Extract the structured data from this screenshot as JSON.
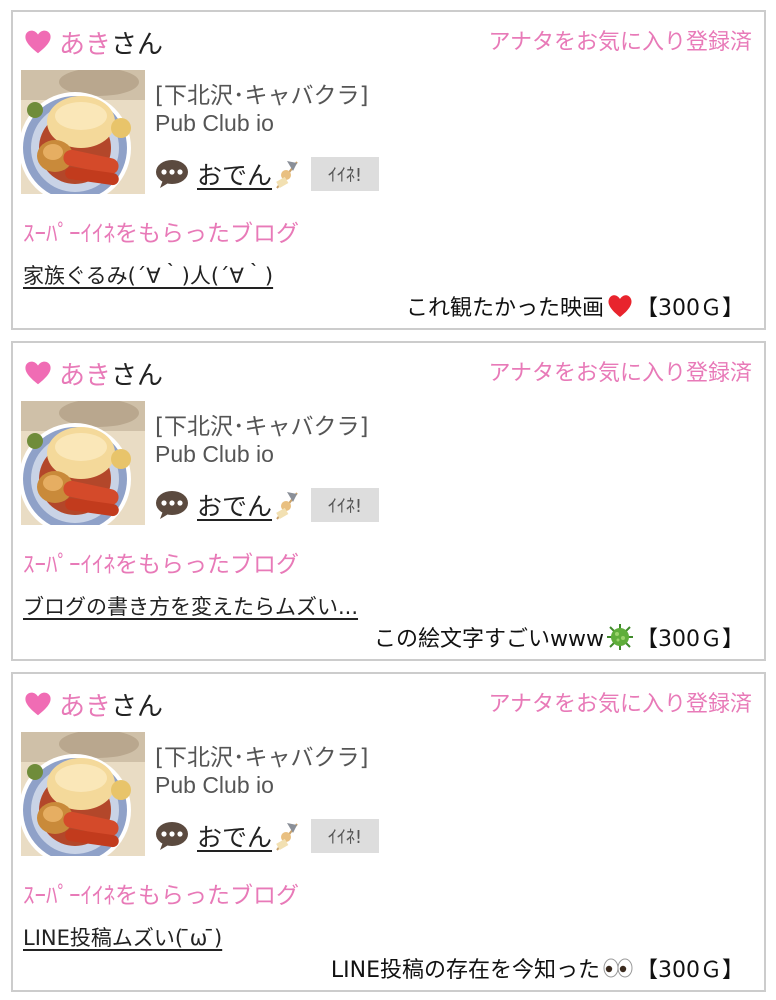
{
  "accent_color": "#e87ab8",
  "cards": [
    {
      "user_name": "あき",
      "user_suffix": "さん",
      "favorite_status": "アナタをお気に入り登録済",
      "shop_area": "[下北沢･キャバクラ]",
      "shop_name": "Pub Club io",
      "blog_title": "おでん",
      "like_label": "ｲｲﾈ!",
      "super_label": "ｽｰﾊﾟｰｲｲﾈをもらったブログ",
      "post_title": "家族ぐるみ(´∀｀)人(´∀｀)",
      "comment_text": "これ観たかった映画",
      "comment_emoji": "red-heart-icon",
      "comment_reward": "【300Ｇ】"
    },
    {
      "user_name": "あき",
      "user_suffix": "さん",
      "favorite_status": "アナタをお気に入り登録済",
      "shop_area": "[下北沢･キャバクラ]",
      "shop_name": "Pub Club io",
      "blog_title": "おでん",
      "like_label": "ｲｲﾈ!",
      "super_label": "ｽｰﾊﾟｰｲｲﾈをもらったブログ",
      "post_title": "ブログの書き方を変えたらムズい...",
      "comment_text": "この絵文字すごいwww",
      "comment_emoji": "virus-icon",
      "comment_reward": "【300Ｇ】"
    },
    {
      "user_name": "あき",
      "user_suffix": "さん",
      "favorite_status": "アナタをお気に入り登録済",
      "shop_area": "[下北沢･キャバクラ]",
      "shop_name": "Pub Club io",
      "blog_title": "おでん",
      "like_label": "ｲｲﾈ!",
      "super_label": "ｽｰﾊﾟｰｲｲﾈをもらったブログ",
      "post_title": "LINE投稿ムズい( ̄ω ̄)",
      "comment_text": "LINE投稿の存在を今知った",
      "comment_emoji": "eyes-icon",
      "comment_reward": "【300Ｇ】"
    }
  ]
}
